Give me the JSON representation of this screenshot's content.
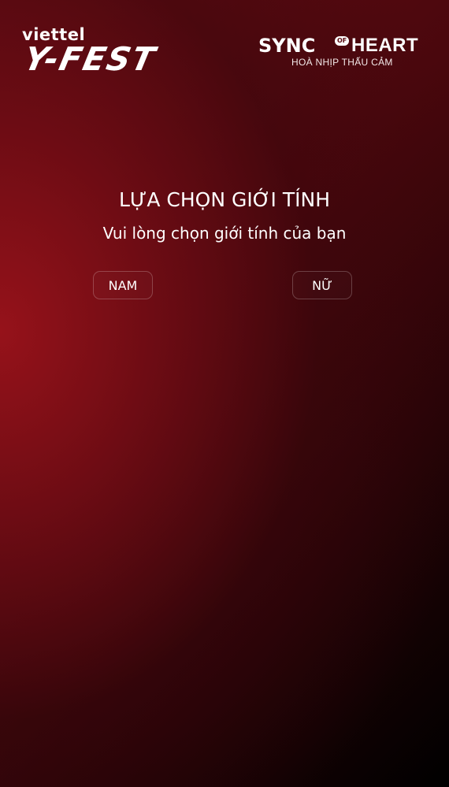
{
  "brand_left": {
    "top_text": "viettel",
    "main_text": "Y-FEST"
  },
  "brand_right": {
    "sync_text": "SYNC",
    "of_text": "OF",
    "heart_text": "HEART",
    "tagline": "HOÀ NHỊP THẤU CẢM"
  },
  "page": {
    "title": "LỰA CHỌN GIỚI TÍNH",
    "subtitle": "Vui lòng chọn giới tính của bạn"
  },
  "options": {
    "male_label": "NAM",
    "female_label": "NỮ"
  },
  "colors": {
    "accent_red": "#960f1a",
    "background_dark": "#000000",
    "text": "#ffffff"
  }
}
